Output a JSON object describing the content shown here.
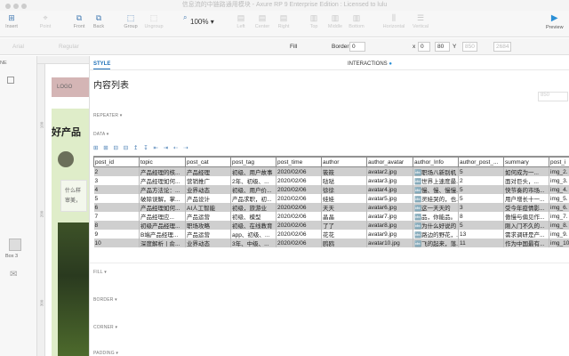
{
  "window": {
    "title": "信息流的中链路通用模块 - Axure RP 9 Enterprise Edition : Licensed to lulu"
  },
  "toolbar": {
    "insert": "Insert",
    "point": "Point",
    "front": "Front",
    "back": "Back",
    "group": "Group",
    "ungroup": "Ungroup",
    "zoom": "100%",
    "left": "Left",
    "center": "Center",
    "right": "Right",
    "top": "Top",
    "middle": "Middle",
    "bottom": "Bottom",
    "horizontal": "Horizontal",
    "vertical": "Vertical",
    "preview": "Preview",
    "x_label": "x",
    "x_value": "0",
    "y_value": "80",
    "y_label": "Y",
    "w_value": "850",
    "h_value": "2684"
  },
  "format": {
    "font": "Arial",
    "weight": "Regular",
    "fill": "Fill",
    "border": "Border:",
    "border_value": "0"
  },
  "left_panel": {
    "page_label": "NE",
    "box_label": "Box 3"
  },
  "canvas": {
    "logo": "LOGO",
    "hero_title": "好产品",
    "card_line1": "什么样",
    "card_line2": "审美，",
    "ruler_marks": [
      "100",
      "200",
      "300"
    ]
  },
  "panel": {
    "tab_style": "STYLE",
    "tab_interactions": "INTERACTIONS",
    "widget_name": "内容列表",
    "width_placeholder": "850",
    "sections": {
      "repeater": "REPEATER ▾",
      "data": "DATA ▾",
      "fill": "FILL ▾",
      "border": "BORDER ▾",
      "corner": "CORNER ▾",
      "padding": "PADDING ▾"
    },
    "data_tools": "⊞ ⊞ ⊟ ⊟ ↥ ↧ ⇤ ⇥ ⇠ ⇢"
  },
  "table": {
    "columns": [
      "post_id",
      "topic",
      "post_cat",
      "post_tag",
      "post_time",
      "author",
      "author_avatar",
      "author_Info",
      "author_post_...",
      "summary",
      "post_i"
    ],
    "rows": [
      [
        "2",
        "产品经理的核...",
        "产品经理",
        "初级、用户故事",
        "2020/02/06",
        "筱筱",
        "avatar2.jpg",
        "🔤职场八新别机",
        "5",
        "如何成为一...",
        "img_2."
      ],
      [
        "3",
        "产品经理如何...",
        "营销推广",
        "2年、初级、...",
        "2020/02/06",
        "哒哒",
        "avatar3.jpg",
        "🔤世界上速度最...",
        "2",
        "面对巨头，...",
        "img_3."
      ],
      [
        "4",
        "产品方法论：...",
        "业界动态",
        "初级、用户价...",
        "2020/02/06",
        "徐徐",
        "avatar4.jpg",
        "🔤慢、慢、慢慢...",
        "5",
        "快节奏的市场...",
        "img_4."
      ],
      [
        "5",
        "破除误解，掌...",
        "产品设计",
        "产品求职，初...",
        "2020/02/06",
        "娃娃",
        "avatar5.jpg",
        "🔤灵娃哭的，也...",
        "5",
        "用户增长十一...",
        "img_5."
      ],
      [
        "6",
        "产品经理如何...",
        "AI人工智能",
        "初级，旅游业",
        "2020/02/06",
        "天天",
        "avatar6.jpg",
        "🔤这一天天的",
        "3",
        "受今年疫情影...",
        "img_6."
      ],
      [
        "7",
        "产品经理应...",
        "产品运营",
        "初级、模型",
        "2020/02/06",
        "晶晶",
        "avatar7.jpg",
        "🔤品，你能品。",
        "8",
        "傲慢与偏见作...",
        "img_7."
      ],
      [
        "8",
        "初级产品经理...",
        "职场攻略",
        "初级、在线教育",
        "2020/02/06",
        "了了",
        "avatar8.jpg",
        "🔤为什么好说的",
        "5",
        "刚入门不久的...",
        "img_8."
      ],
      [
        "9",
        "B端产品经理...",
        "产品运营",
        "app、初级、...",
        "2020/02/06",
        "花花",
        "avatar9.jpg",
        "🔤路边的野花，...",
        "13",
        "需求调研是产...",
        "img_9."
      ],
      [
        "10",
        "深度解析丨俞...",
        "业界动态",
        "3年、中级、...",
        "2020/02/06",
        "鸥鸥",
        "avatar10.jpg",
        "🔤飞的起来，落...",
        "11",
        "作为中国最有...",
        "img_10"
      ]
    ]
  },
  "colors": {
    "accent": "#1d6fb8",
    "row_stripe": "#cfcfcf",
    "canvas_green": "#dfedc9",
    "logo_bg": "#d4b5b5"
  }
}
